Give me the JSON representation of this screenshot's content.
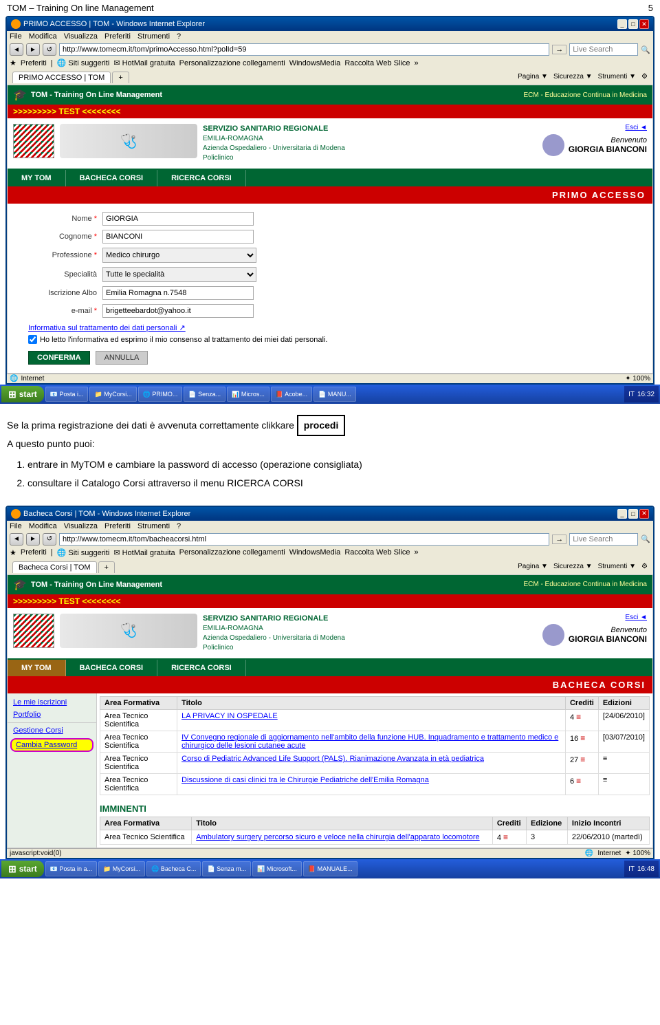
{
  "page": {
    "title": "TOM – Training On line Management",
    "page_number": "5"
  },
  "browser1": {
    "title": "PRIMO ACCESSO | TOM - Windows Internet Explorer",
    "url": "http://www.tomecm.it/tom/primoAccesso.html?polId=59",
    "tab_label": "PRIMO ACCESSO | TOM",
    "menu_items": [
      "File",
      "Modifica",
      "Visualizza",
      "Preferiti",
      "Strumenti",
      "?"
    ],
    "favorites_label": "Preferiti",
    "search_placeholder": "Live Search",
    "nav_buttons": [
      "◄",
      "►",
      "↺"
    ],
    "toolbar_items": [
      "Siti suggeriti",
      "HotMail gratuita",
      "Personalizzazione collegamenti",
      "WindowsMedia",
      "Raccolta Web Slice"
    ],
    "ie_tools": [
      "Pagina",
      "Sicurezza",
      "Strumenti"
    ]
  },
  "tom_app1": {
    "header_title": "TOM - Training On Line Management",
    "header_ecm": "ECM - Educazione Continua in Medicina",
    "test_banner": ">>>>>>>>> TEST <<<<<<<<",
    "servizio_name": "SERVIZIO SANITARIO REGIONALE",
    "servizio_region": "EMILIA-ROMAGNA",
    "servizio_az": "Azienda Ospedaliero - Universitaria di Modena",
    "servizio_poli": "Policlinico",
    "benvenuto_label": "Benvenuto",
    "username": "GIORGIA BIANCONI",
    "esci_label": "Esci ◄",
    "nav_items": [
      "MY TOM",
      "BACHECA CORSI",
      "RICERCA CORSI"
    ],
    "primo_accesso_label": "PRIMO ACCESSO",
    "form": {
      "nome_label": "Nome",
      "nome_value": "GIORGIA",
      "cognome_label": "Cognome",
      "cognome_value": "BIANCONI",
      "professione_label": "Professione",
      "professione_value": "Medico chirurgo",
      "specialita_label": "Specialità",
      "specialita_value": "Tutte le specialità",
      "iscrizione_label": "Iscrizione Albo",
      "iscrizione_value": "Emilia Romagna n.7548",
      "email_label": "e-mail",
      "email_value": "brigetteebardot@yahoo.it",
      "privacy_title": "Informativa sul trattamento dei dati personali ↗",
      "privacy_check_text": "Ho letto l'informativa ed esprimo il mio consenso al trattamento dei miei dati personali.",
      "btn_conferma": "CONFERMA",
      "btn_annulla": "ANNULLA"
    }
  },
  "browser1_status": {
    "internet_label": "Internet",
    "zoom_label": "✦ 100%"
  },
  "taskbar1": {
    "start_label": "start",
    "buttons": [
      "Posta i...",
      "MyCorsi...",
      "PRIMO...",
      "Senza...",
      "Micros...",
      "Acobe...",
      "MANU..."
    ],
    "lang": "IT",
    "time": "16:32"
  },
  "middle": {
    "text1": "Se la prima registrazione dei dati è avvenuta correttamente clikkare",
    "procedi_label": "procedi",
    "text2": "A questo punto puoi:",
    "item1": "entrare in MyTOM e cambiare la password di accesso (operazione consigliata)",
    "item2": "consultare il Catalogo Corsi attraverso il menu RICERCA CORSI"
  },
  "browser2": {
    "title": "Bacheca Corsi | TOM - Windows Internet Explorer",
    "url": "http://www.tomecm.it/tom/bacheacorsi.html",
    "tab_label": "Bacheca Corsi | TOM",
    "menu_items": [
      "File",
      "Modifica",
      "Visualizza",
      "Preferiti",
      "Strumenti",
      "?"
    ],
    "favorites_label": "Preferiti",
    "search_placeholder": "Live Search",
    "ie_tools": [
      "Pagina",
      "Sicurezza",
      "Strumenti"
    ]
  },
  "tom_app2": {
    "header_title": "TOM - Training On Line Management",
    "header_ecm": "ECM - Educazione Continua in Medicina",
    "test_banner": ">>>>>>>>> TEST <<<<<<<<",
    "servizio_name": "SERVIZIO SANITARIO REGIONALE",
    "servizio_region": "EMILIA-ROMAGNA",
    "servizio_az": "Azienda Ospedaliero - Universitaria di Modena",
    "servizio_poli": "Policlinico",
    "benvenuto_label": "Benvenuto",
    "username": "GIORGIA BIANCONI",
    "esci_label": "Esci ◄",
    "nav_items": [
      "MY TOM",
      "BACHECA CORSI",
      "RICERCA CORSI"
    ],
    "bacheca_label": "BACHECA CORSI",
    "sidebar": {
      "links": [
        "Le mie iscrizioni",
        "Portfolio",
        "Cambia Password"
      ],
      "highlighted": "Cambia Password"
    },
    "courses_table": {
      "headers": [
        "Area Formativa",
        "Titolo",
        "Crediti",
        "Edizioni"
      ],
      "rows": [
        {
          "area": "Area Tecnico Scientifica",
          "titolo": "LA PRIVACY IN OSPEDALE",
          "crediti": "4",
          "edizioni": "[24/06/2010]"
        },
        {
          "area": "Area Tecnico Scientifica",
          "titolo": "IV Convegno regionale di aggiornamento nell'ambito della funzione HUB. Inquadramento e trattamento medico e chirurgico delle lesioni cutanee acute",
          "crediti": "16",
          "edizioni": "[03/07/2010]"
        },
        {
          "area": "Area Tecnico Scientifica",
          "titolo": "Corso di Pediatric Advanced Life Support (PALS). Rianimazione Avanzata in età pediatrica",
          "crediti": "27",
          "edizioni": "≡"
        },
        {
          "area": "Area Tecnico Scientifica",
          "titolo": "Discussione di casi clinici tra le Chirurgie Pediatriche dell'Emilia Romagna",
          "crediti": "6",
          "edizioni": "≡"
        }
      ]
    },
    "imminenti_section": {
      "title": "IMMINENTI",
      "headers": [
        "Area Formativa",
        "Titolo",
        "Crediti",
        "Edizione",
        "Inizio Incontri"
      ],
      "rows": [
        {
          "area": "Area Tecnico Scientifica",
          "titolo": "Ambulatory surgery percorso sicuro e veloce nella chirurgia dell'apparato locomotore",
          "crediti": "4",
          "edizione": "3",
          "inizio": "22/06/2010 (martedì)"
        }
      ]
    }
  },
  "browser2_status": {
    "url_bottom": "javascript:void(0)",
    "internet_label": "Internet",
    "zoom_label": "✦ 100%"
  },
  "taskbar2": {
    "start_label": "start",
    "buttons": [
      "Posta in a...",
      "MyCorsi...",
      "Bacheca C...",
      "Senza m...",
      "Microsoft...",
      "MANUALE..."
    ],
    "lang": "IT",
    "time": "16:48"
  }
}
